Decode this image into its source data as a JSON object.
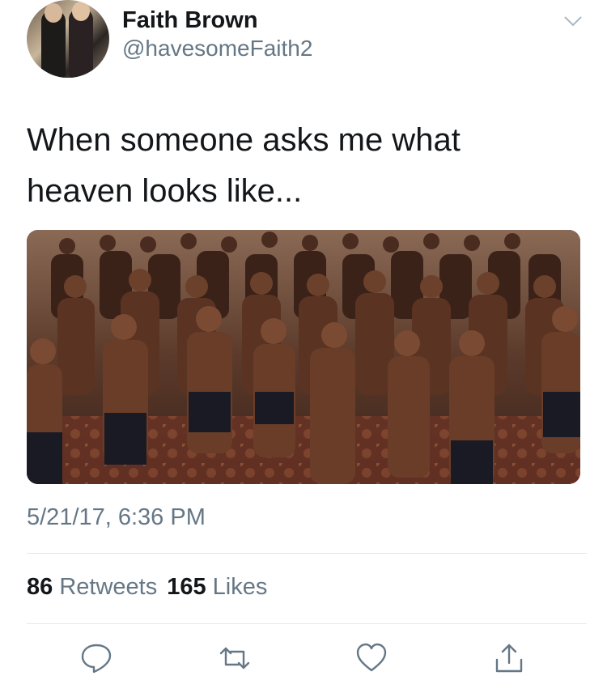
{
  "author": {
    "name": "Faith Brown",
    "handle": "@havesomeFaith2"
  },
  "tweet": {
    "text": "When someone asks me what\nheaven looks like...",
    "timestamp": "5/21/17, 6:36 PM",
    "media_description": "Group photo of shirtless football players posing in a hotel ballroom"
  },
  "stats": {
    "retweets_count": "86",
    "retweets_label": "Retweets",
    "likes_count": "165",
    "likes_label": "Likes"
  },
  "icons": {
    "menu": "chevron-down-icon",
    "reply": "reply-icon",
    "retweet": "retweet-icon",
    "like": "heart-icon",
    "share": "share-icon"
  },
  "colors": {
    "text_primary": "#14171a",
    "text_secondary": "#657786",
    "divider": "#e1e8ed",
    "icon": "#657786"
  }
}
